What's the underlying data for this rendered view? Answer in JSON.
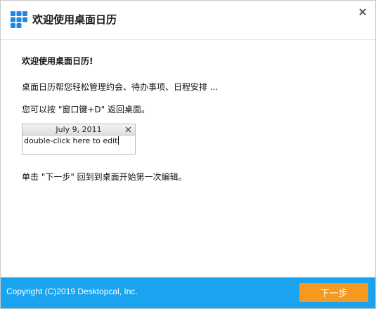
{
  "window": {
    "title": "欢迎使用桌面日历",
    "close_icon": "close-icon"
  },
  "content": {
    "heading": "欢迎使用桌面日历!",
    "line1": "桌面日历帮您轻松管理约会、待办事项、日程安排 ...",
    "line2": "您可以按 \"窗口键+D\" 返回桌面。",
    "note": {
      "date": "July 9, 2011",
      "text": "double-click here to edit"
    },
    "line3": "单击 \"下一步\" 回到到桌面开始第一次编辑。"
  },
  "footer": {
    "copyright": "Copyright (C)2019 Desktopcal, Inc.",
    "next_label": "下一步"
  },
  "colors": {
    "footer_bg": "#1aa3ef",
    "next_button": "#f59a1e",
    "logo_blue": "#1e88e5"
  }
}
